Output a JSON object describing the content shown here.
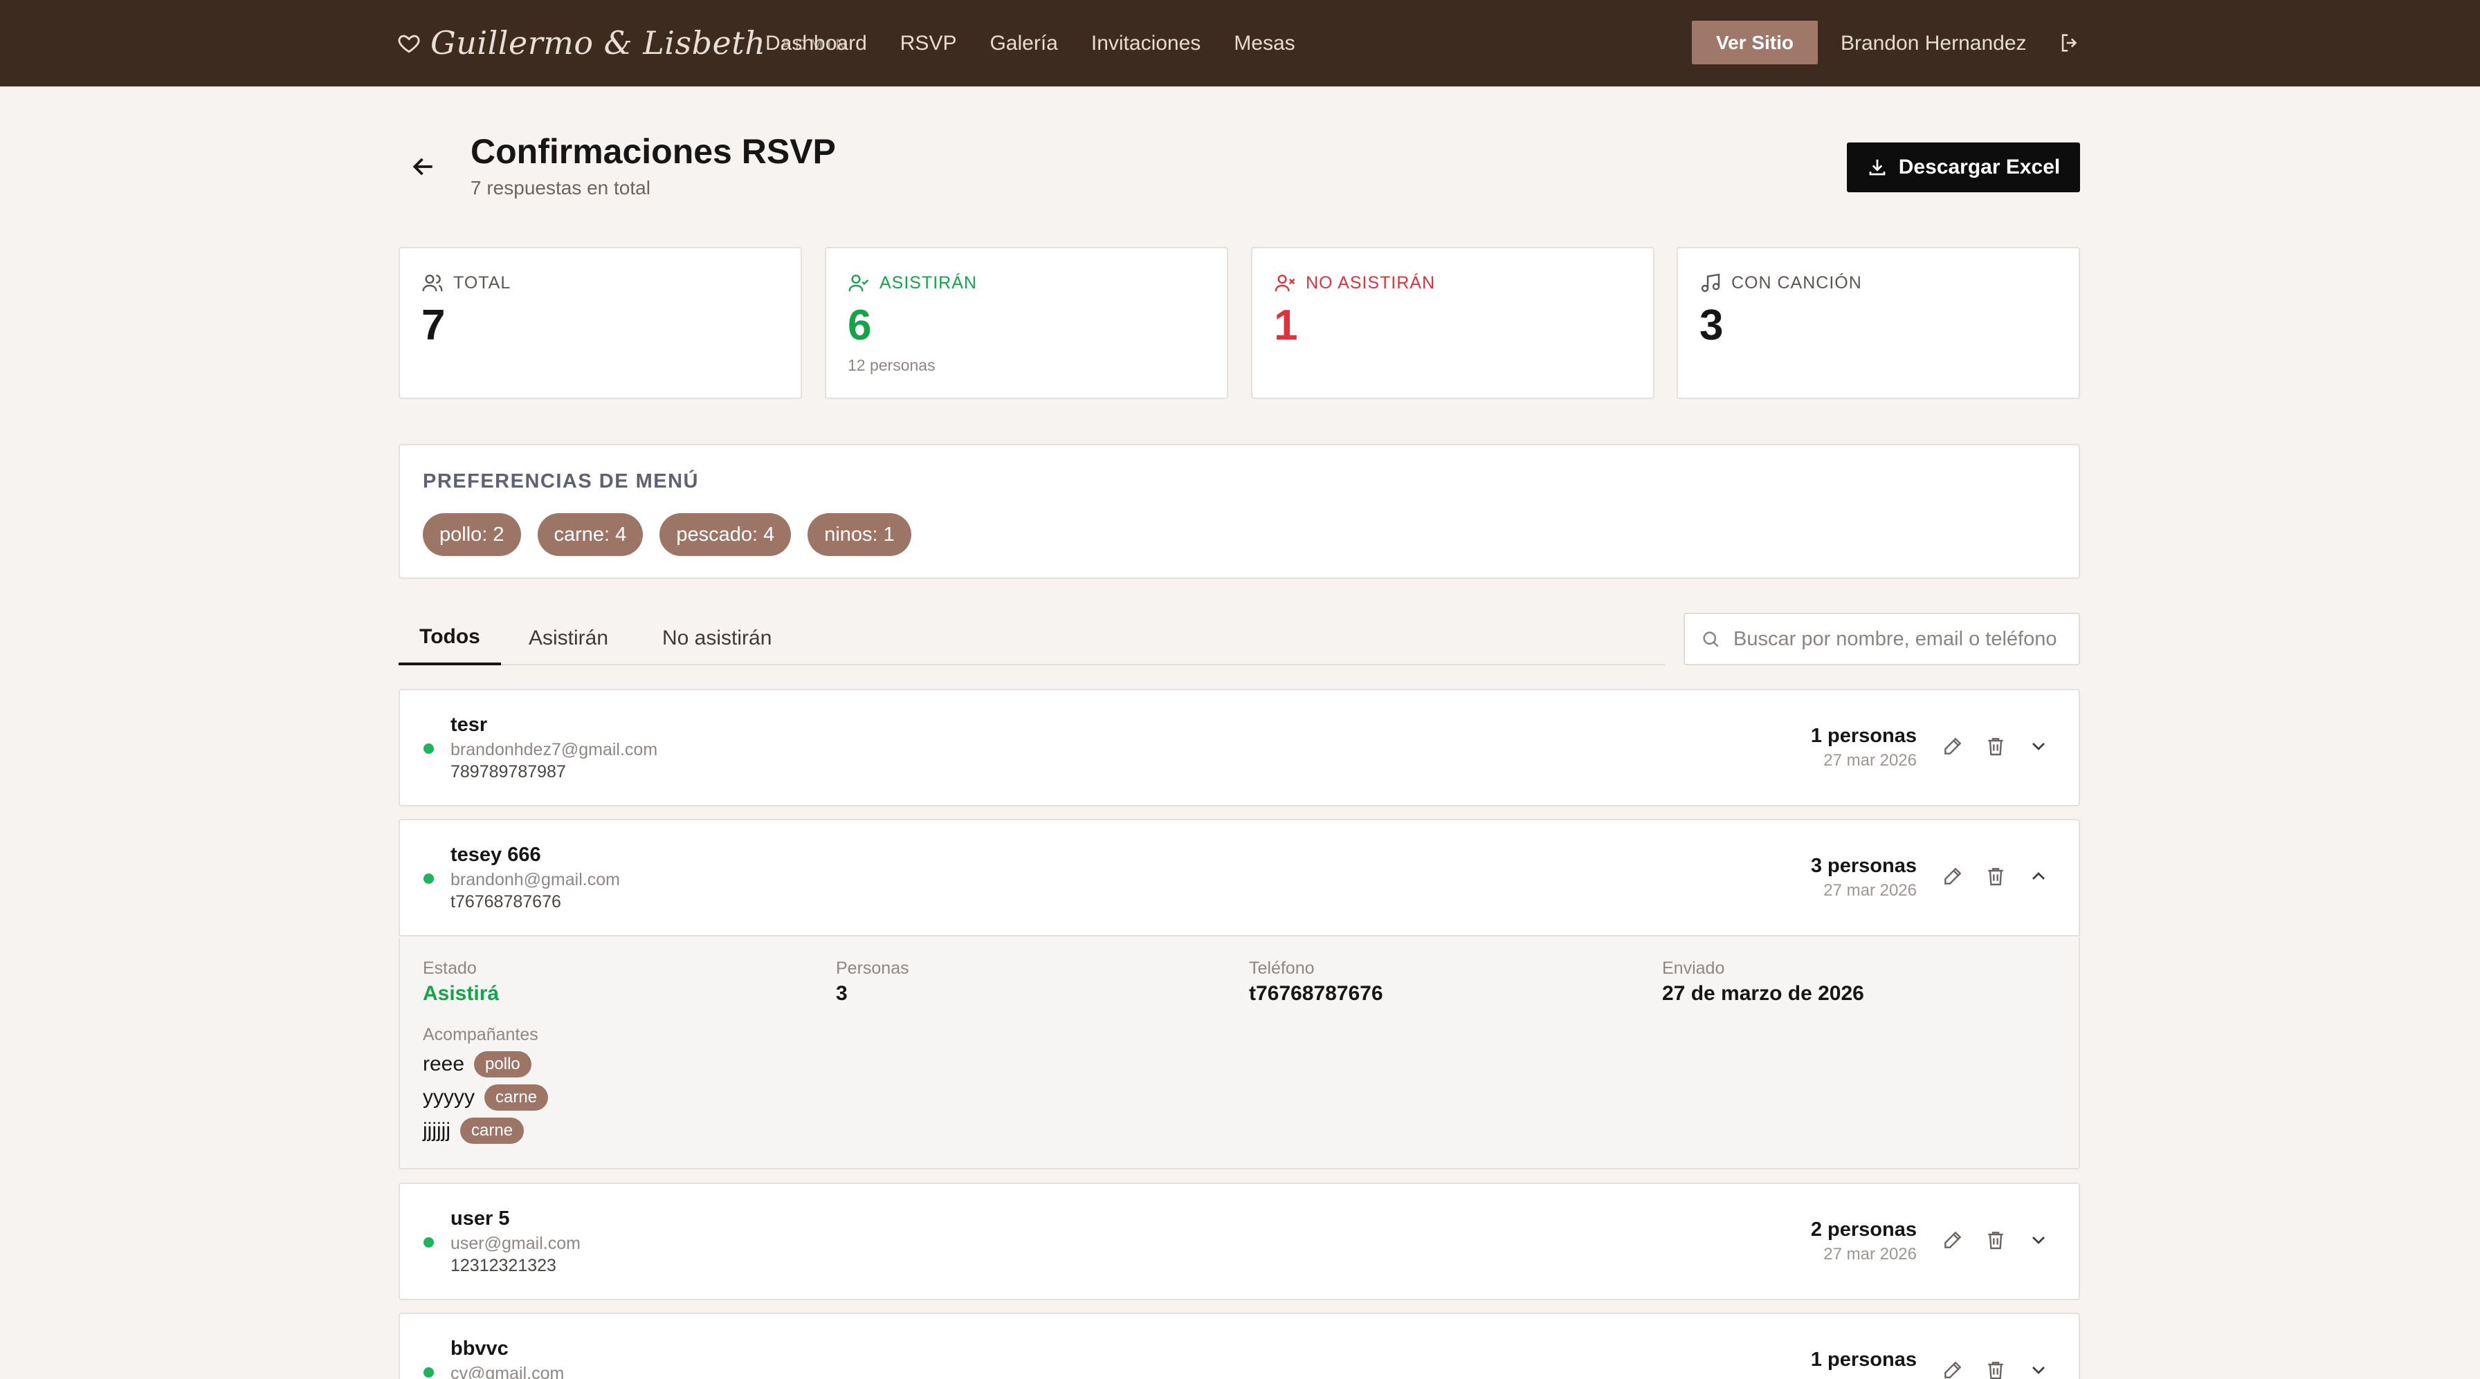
{
  "header": {
    "brand_name": "Guillermo & Lisbeth",
    "brand_tag": "ADMIN",
    "nav": [
      "Dashboard",
      "RSVP",
      "Galería",
      "Invitaciones",
      "Mesas"
    ],
    "view_site_label": "Ver Sitio",
    "user_name": "Brandon Hernandez"
  },
  "page": {
    "title": "Confirmaciones RSVP",
    "subtitle": "7 respuestas en total",
    "export_label": "Descargar Excel"
  },
  "stats": [
    {
      "label": "TOTAL",
      "value": "7",
      "note": "",
      "color": "#5b5654"
    },
    {
      "label": "ASISTIRÁN",
      "value": "6",
      "note": "12 personas",
      "color": "#17a34a"
    },
    {
      "label": "NO ASISTIRÁN",
      "value": "1",
      "note": "",
      "color": "#e0323c"
    },
    {
      "label": "CON CANCIÓN",
      "value": "3",
      "note": "",
      "color": "#5b5654"
    }
  ],
  "menu": {
    "title": "PREFERENCIAS DE MENÚ",
    "chips": [
      "pollo: 2",
      "carne: 4",
      "pescado: 4",
      "ninos: 1"
    ]
  },
  "tabs": [
    "Todos",
    "Asistirán",
    "No asistirán"
  ],
  "search": {
    "placeholder": "Buscar por nombre, email o teléfono"
  },
  "rsvps": [
    {
      "name": "tesr",
      "email": "brandonhdez7@gmail.com",
      "phone": "789789787987",
      "count": "1 personas",
      "date": "27 mar 2026"
    },
    {
      "name": "tesey 666",
      "email": "brandonh@gmail.com",
      "phone": "t76768787676",
      "count": "3 personas",
      "date": "27 mar 2026"
    },
    {
      "name": "user 5",
      "email": "user@gmail.com",
      "phone": "12312321323",
      "count": "2 personas",
      "date": "27 mar 2026"
    },
    {
      "name": "bbvvc",
      "email": "cv@gmail.com",
      "phone": "",
      "count": "1 personas",
      "date": ""
    }
  ],
  "detail": {
    "estado_label": "Estado",
    "estado_value": "Asistirá",
    "personas_label": "Personas",
    "personas_value": "3",
    "telefono_label": "Teléfono",
    "telefono_value": "t76768787676",
    "enviado_label": "Enviado",
    "enviado_value": "27 de marzo de 2026",
    "companions_label": "Acompañantes",
    "companions": [
      {
        "name": "reee",
        "menu": "pollo"
      },
      {
        "name": "yyyyy",
        "menu": "carne"
      },
      {
        "name": "jjjjjj",
        "menu": "carne"
      }
    ]
  },
  "icons": {
    "brand": "heart-icon",
    "logout": "logout-icon",
    "back": "arrow-left-icon",
    "download": "download-icon",
    "search": "search-icon",
    "edit": "pencil-icon",
    "delete": "trash-icon",
    "expand": "chevron-down-icon",
    "collapse": "chevron-up-icon"
  },
  "colors": {
    "header_bg": "#3d2b20",
    "accent": "#9c7566",
    "page_bg": "#f7f3f0",
    "attending": "#17a34a",
    "not_attending": "#e0323c"
  }
}
